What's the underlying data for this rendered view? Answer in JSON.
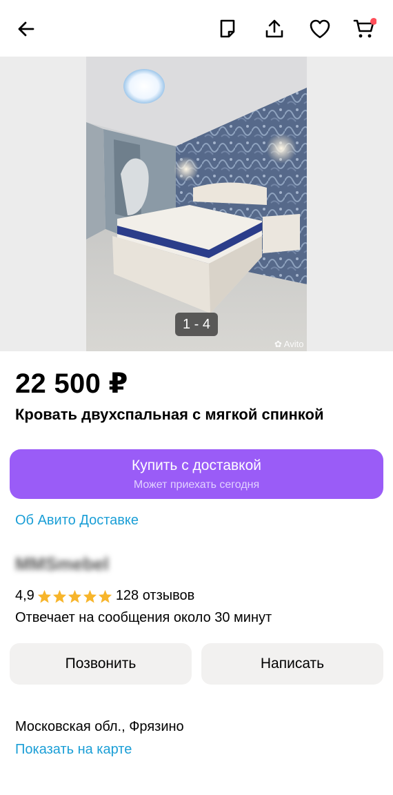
{
  "header": {
    "icons": [
      "back-arrow-icon",
      "note-icon",
      "share-icon",
      "heart-icon",
      "cart-icon"
    ],
    "cart_badge_color": "#ff4f5a"
  },
  "gallery": {
    "counter": "1 - 4",
    "watermark": "Avito"
  },
  "listing": {
    "price": "22 500 ₽",
    "title": "Кровать двухспальная с мягкой спинкой"
  },
  "delivery": {
    "buy_label": "Купить с доставкой",
    "buy_sublabel": "Может приехать сегодня",
    "about_link": "Об Авито Доставке",
    "accent_color": "#9a5cf7"
  },
  "seller": {
    "name": "MMSmebel",
    "rating": "4,9",
    "stars": 5,
    "reviews": "128 отзывов",
    "reply_time": "Отвечает на сообщения около 30 минут"
  },
  "actions": {
    "call": "Позвонить",
    "write": "Написать"
  },
  "location": {
    "address": "Московская обл., Фрязино",
    "map_link": "Показать на карте"
  },
  "colors": {
    "link": "#1a9ed6",
    "star": "#f7b52b",
    "button_bg": "#f2f1f0"
  }
}
